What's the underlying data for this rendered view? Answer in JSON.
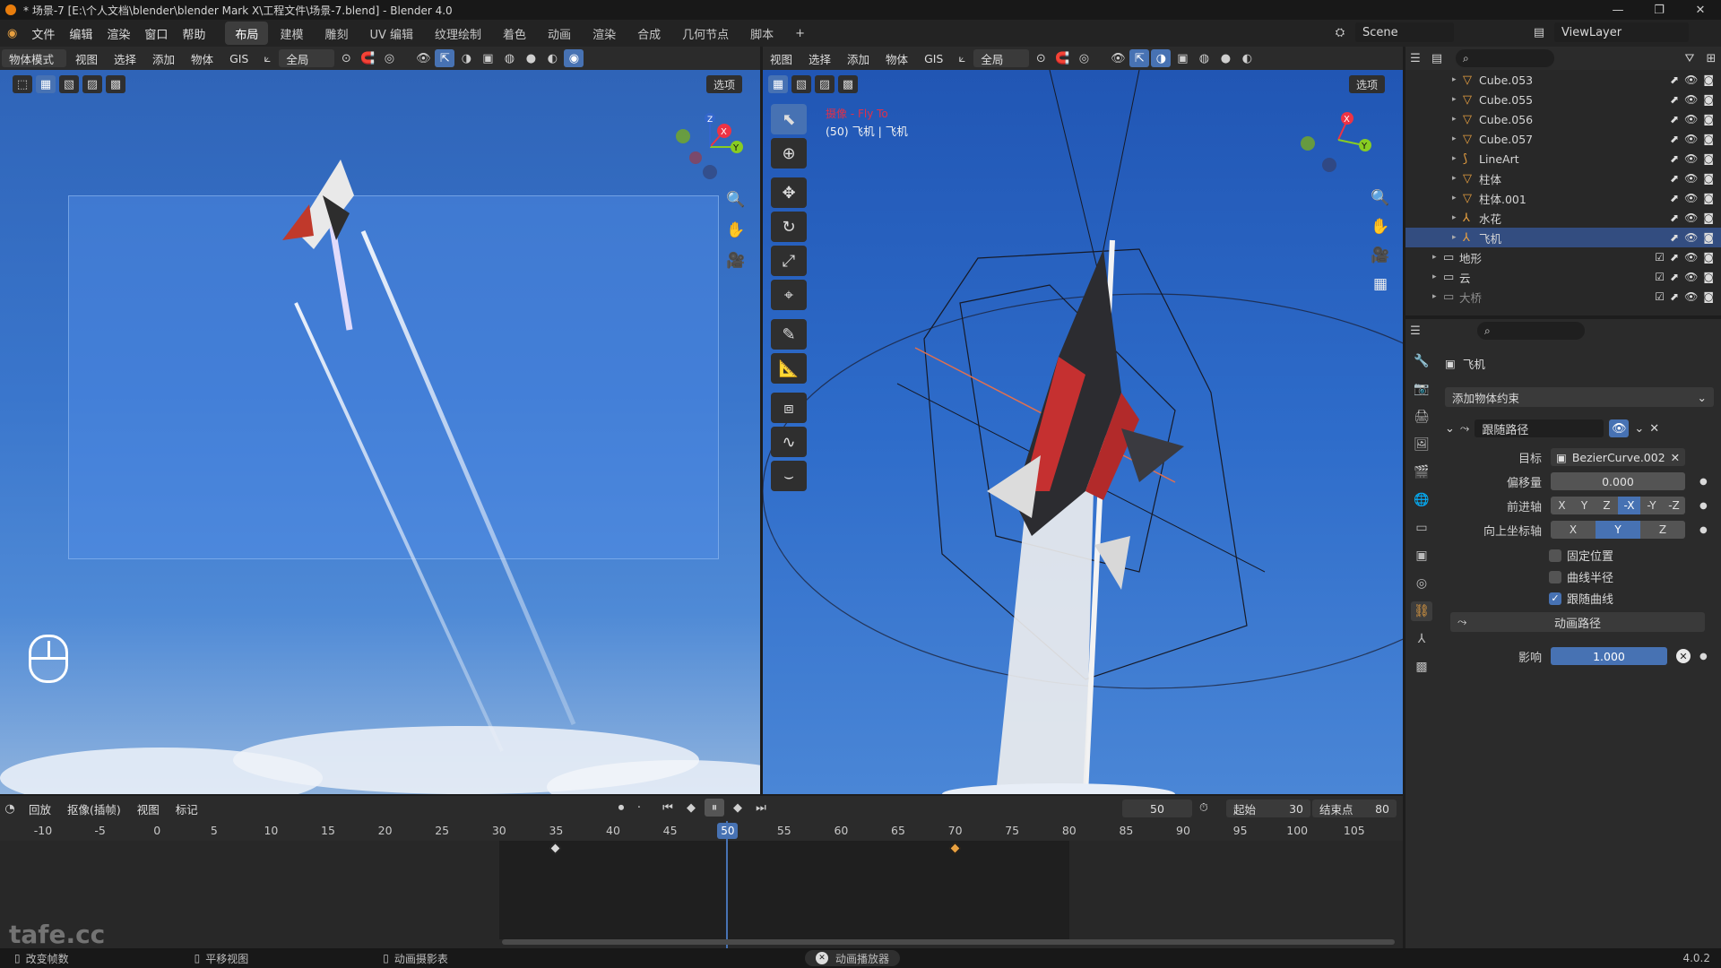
{
  "window": {
    "title": "* 场景-7 [E:\\个人文档\\blender\\blender Mark X\\工程文件\\场景-7.blend] - Blender 4.0"
  },
  "menus": [
    "文件",
    "编辑",
    "渲染",
    "窗口",
    "帮助"
  ],
  "workspaces": [
    "布局",
    "建模",
    "雕刻",
    "UV 编辑",
    "纹理绘制",
    "着色",
    "动画",
    "渲染",
    "合成",
    "几何节点",
    "脚本"
  ],
  "scene": {
    "name": "Scene",
    "view_layer": "ViewLayer"
  },
  "left_viewport": {
    "mode": "物体模式",
    "menu": [
      "视图",
      "选择",
      "添加",
      "物体",
      "GIS"
    ],
    "transform": "全局",
    "options_label": "选项"
  },
  "right_viewport": {
    "menu": [
      "视图",
      "选择",
      "添加",
      "物体",
      "GIS"
    ],
    "transform": "全局",
    "options_label": "选项",
    "overlay_title": "摄像 - Fly To",
    "overlay_subtitle": "(50) 飞机 | 飞机"
  },
  "outliner": {
    "items": [
      {
        "name": "Cube.053",
        "selected": false
      },
      {
        "name": "Cube.055",
        "selected": false
      },
      {
        "name": "Cube.056",
        "selected": false
      },
      {
        "name": "Cube.057",
        "selected": false
      },
      {
        "name": "LineArt",
        "selected": false
      },
      {
        "name": "柱体",
        "selected": false
      },
      {
        "name": "柱体.001",
        "selected": false
      },
      {
        "name": "水花",
        "selected": false
      },
      {
        "name": "飞机",
        "selected": true
      },
      {
        "name": "地形",
        "selected": false
      },
      {
        "name": "云",
        "selected": false
      },
      {
        "name": "大桥",
        "selected": false
      }
    ]
  },
  "properties": {
    "object_name": "飞机",
    "add_constraint": "添加物体约束",
    "constraint_name": "跟随路径",
    "target_label": "目标",
    "target_value": "BezierCurve.002",
    "offset_label": "偏移量",
    "offset_value": "0.000",
    "forward_label": "前进轴",
    "forward_axes": [
      "X",
      "Y",
      "Z",
      "-X",
      "-Y",
      "-Z"
    ],
    "forward_selected": "-X",
    "up_label": "向上坐标轴",
    "up_axes": [
      "X",
      "Y",
      "Z"
    ],
    "up_selected": "Y",
    "fixed_position": {
      "label": "固定位置",
      "checked": false
    },
    "curve_radius": {
      "label": "曲线半径",
      "checked": false
    },
    "follow_curve": {
      "label": "跟随曲线",
      "checked": true
    },
    "animate_path": "动画路径",
    "influence_label": "影响",
    "influence_value": "1.000"
  },
  "timeline": {
    "menu": [
      "回放",
      "抠像(插帧)",
      "视图",
      "标记"
    ],
    "current_frame": "50",
    "start_label": "起始",
    "start_value": "30",
    "end_label": "结束点",
    "end_value": "80",
    "ticks": [
      "-10",
      "-5",
      "0",
      "5",
      "10",
      "15",
      "20",
      "25",
      "30",
      "35",
      "40",
      "45",
      "50",
      "55",
      "60",
      "65",
      "70",
      "75",
      "80",
      "85",
      "90",
      "95",
      "100",
      "105"
    ],
    "keyframes": [
      35,
      70
    ]
  },
  "status_bar": {
    "items": [
      "改变帧数",
      "平移视图",
      "动画摄影表"
    ],
    "center": "动画播放器",
    "version": "4.0.2"
  },
  "watermark": "tafe.cc",
  "colors": {
    "accent": "#4772b3",
    "selection": "#334d80",
    "orange": "#e8a040"
  }
}
